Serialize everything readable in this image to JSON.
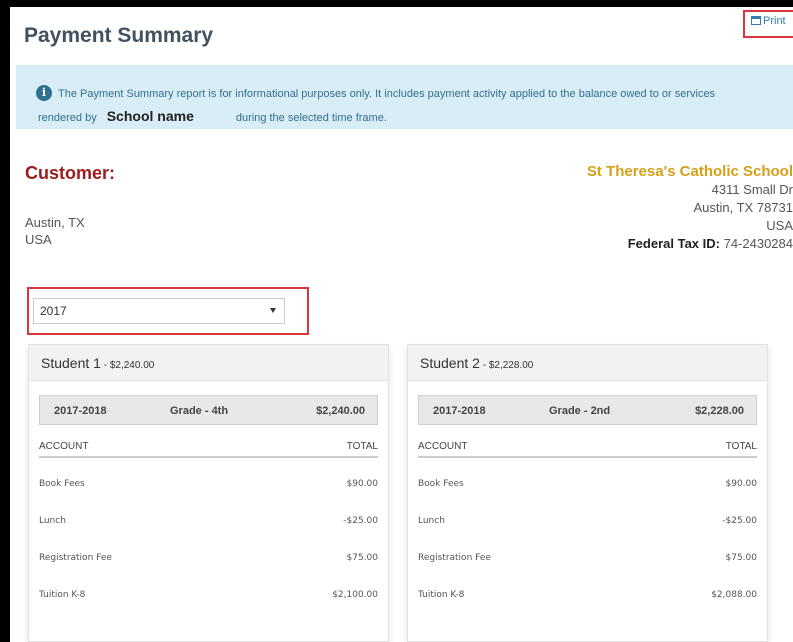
{
  "header": {
    "title": "Payment Summary",
    "print_label": "Print"
  },
  "info": {
    "text_line1": "The Payment Summary report is for informational purposes only. It includes payment activity applied to the balance owed to or services",
    "text_line2_pre": "rendered by",
    "school_name": "School name",
    "text_line2_post": "during the selected time frame."
  },
  "customer": {
    "label": "Customer:",
    "city": "Austin, TX",
    "country": "USA"
  },
  "school": {
    "name": "St Theresa's Catholic School",
    "street": "4311 Small Dr",
    "city": "Austin, TX 78731",
    "country": "USA",
    "tax_label": "Federal Tax ID:",
    "tax_id": "74-2430284"
  },
  "year_select": {
    "value": "2017"
  },
  "students": [
    {
      "name": "Student 1",
      "total": " - $2,240.00",
      "school_year": "2017-2018",
      "grade": "Grade - 4th",
      "grade_total": "$2,240.00",
      "col_account": "ACCOUNT",
      "col_total": "TOTAL",
      "rows": [
        {
          "account": "Book Fees",
          "total": "$90.00"
        },
        {
          "account": "Lunch",
          "total": "-$25.00"
        },
        {
          "account": "Registration Fee",
          "total": "$75.00"
        },
        {
          "account": "Tuition K-8",
          "total": "$2,100.00"
        }
      ]
    },
    {
      "name": "Student 2",
      "total": " - $2,228.00",
      "school_year": "2017-2018",
      "grade": "Grade - 2nd",
      "grade_total": "$2,228.00",
      "col_account": "ACCOUNT",
      "col_total": "TOTAL",
      "rows": [
        {
          "account": "Book Fees",
          "total": "$90.00"
        },
        {
          "account": "Lunch",
          "total": "-$25.00"
        },
        {
          "account": "Registration Fee",
          "total": "$75.00"
        },
        {
          "account": "Tuition K-8",
          "total": "$2,088.00"
        }
      ]
    }
  ],
  "colors": {
    "customer_label": "#9b1c1c",
    "school_name": "#d4a017",
    "highlight_border": "#d9363e",
    "info_bg": "#d9edf7"
  }
}
